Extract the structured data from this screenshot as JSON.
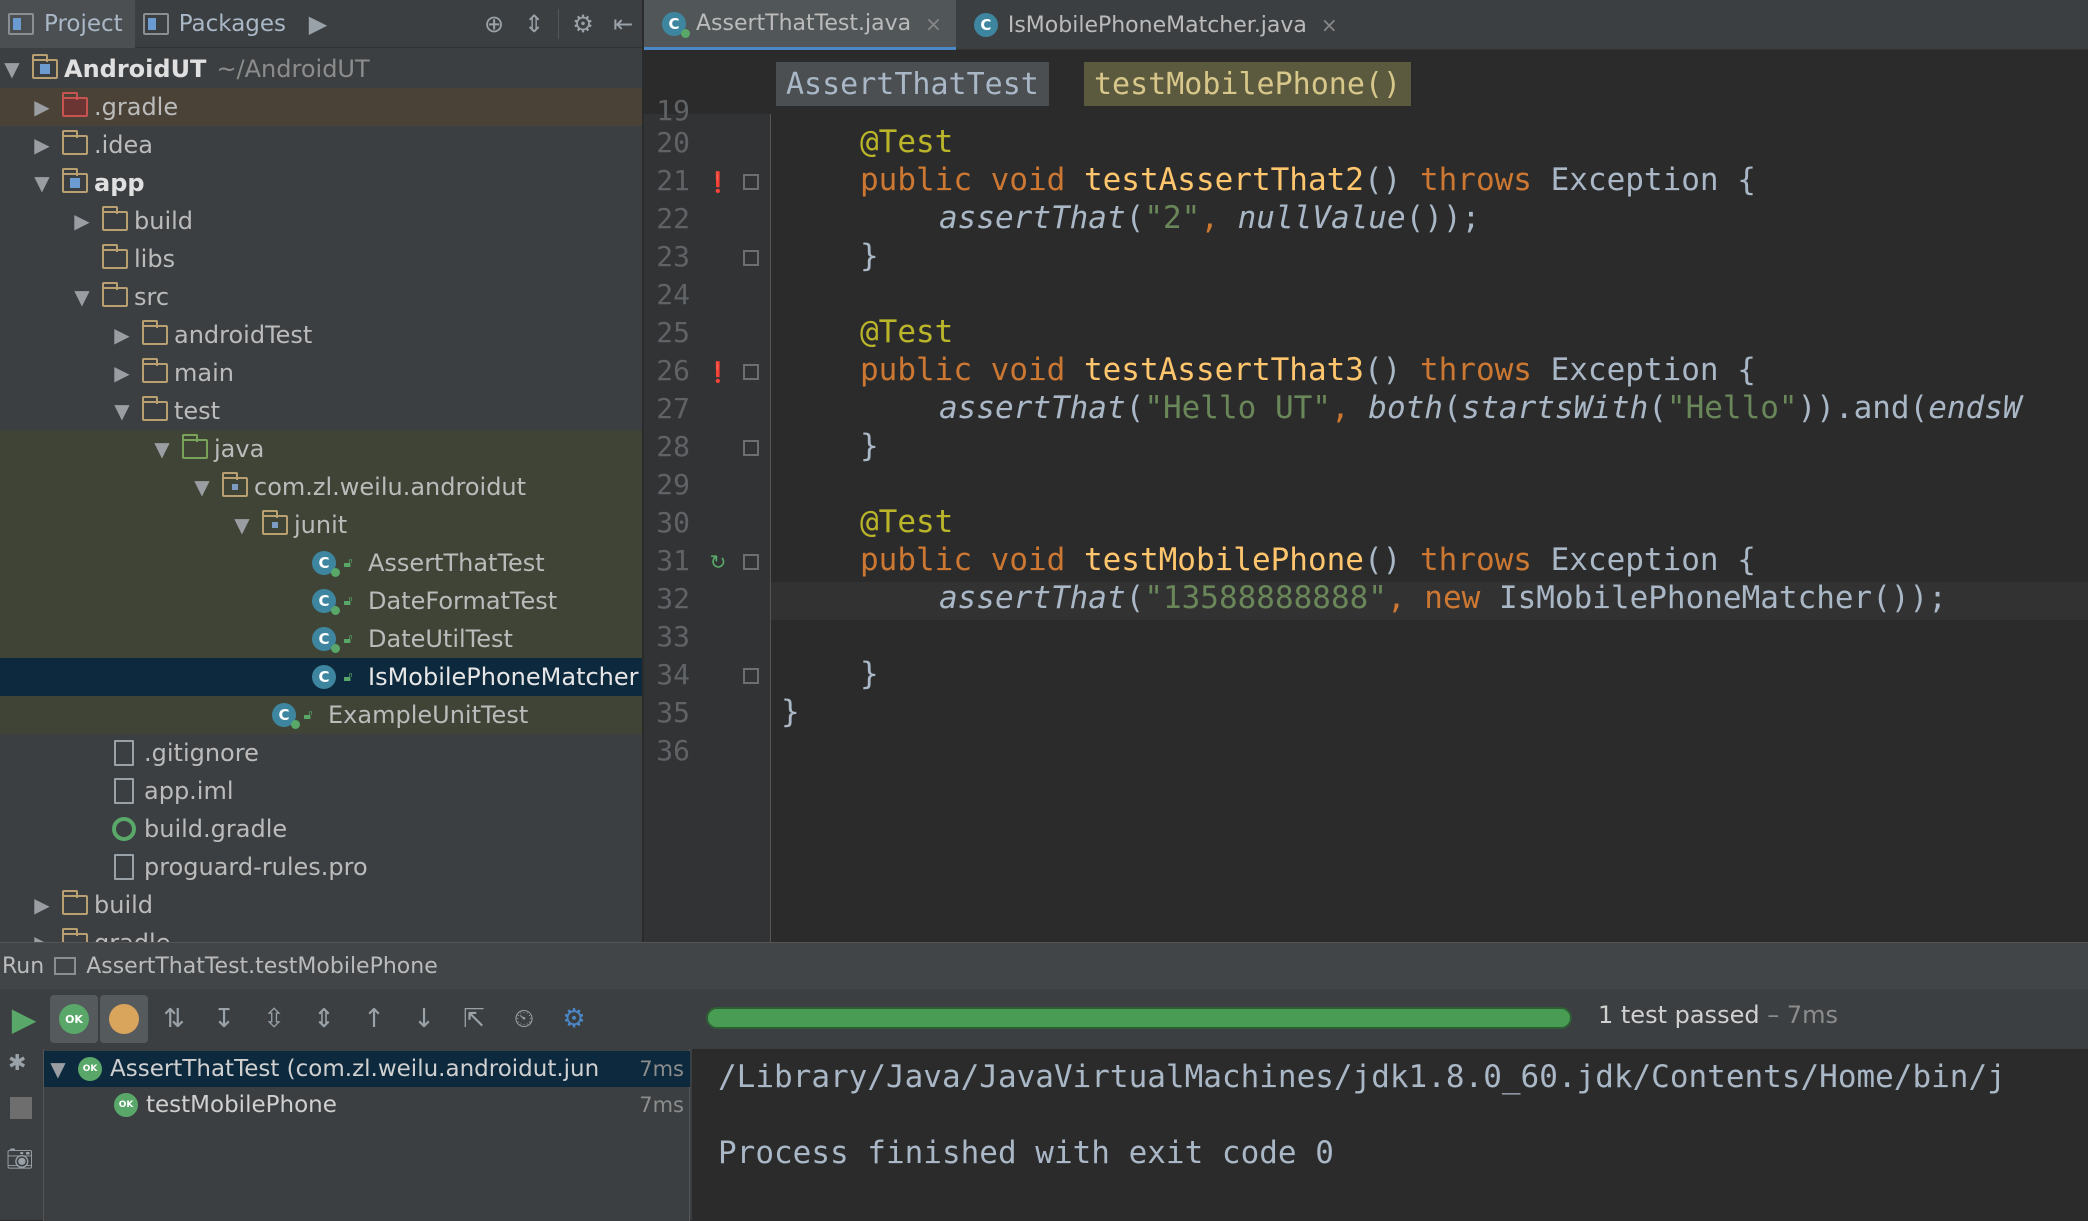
{
  "project_panel": {
    "tabs": [
      "Project",
      "Packages"
    ],
    "root_name": "AndroidUT",
    "root_path": "~/AndroidUT",
    "items": [
      {
        "label": ".gradle"
      },
      {
        "label": ".idea"
      },
      {
        "label": "app"
      },
      {
        "label": "build"
      },
      {
        "label": "libs"
      },
      {
        "label": "src"
      },
      {
        "label": "androidTest"
      },
      {
        "label": "main"
      },
      {
        "label": "test"
      },
      {
        "label": "java"
      },
      {
        "label": "com.zl.weilu.androidut"
      },
      {
        "label": "junit"
      },
      {
        "label": "AssertThatTest"
      },
      {
        "label": "DateFormatTest"
      },
      {
        "label": "DateUtilTest"
      },
      {
        "label": "IsMobilePhoneMatcher"
      },
      {
        "label": "ExampleUnitTest"
      },
      {
        "label": ".gitignore"
      },
      {
        "label": "app.iml"
      },
      {
        "label": "build.gradle"
      },
      {
        "label": "proguard-rules.pro"
      },
      {
        "label": "build"
      },
      {
        "label": "gradle"
      }
    ]
  },
  "editor": {
    "tabs": [
      {
        "label": "AssertThatTest.java",
        "close": "×"
      },
      {
        "label": "IsMobilePhoneMatcher.java",
        "close": "×"
      }
    ],
    "breadcrumb": [
      "AssertThatTest",
      "testMobilePhone()"
    ],
    "line_numbers": [
      "20",
      "21",
      "22",
      "23",
      "24",
      "25",
      "26",
      "27",
      "28",
      "29",
      "30",
      "31",
      "32",
      "33",
      "34",
      "35",
      "36"
    ],
    "code": {
      "ann": "@Test",
      "public": "public",
      "void": "void",
      "throws": "throws",
      "exception": "Exception {",
      "new": "new",
      "m1": "testAssertThat2",
      "m2": "testAssertThat3",
      "m3": "testMobilePhone",
      "call1_fn": "assertThat",
      "str_2": "\"2\"",
      "null_value": "nullValue",
      "str_hello_ut": "\"Hello UT\"",
      "both": "both",
      "starts_with": "startsWith",
      "str_hello": "\"Hello\"",
      "and_part": ".and(",
      "ends_part": "endsW",
      "str_phone": "\"13588888888\"",
      "matcher": "IsMobilePhoneMatcher());",
      "close_brace": "}",
      "paren_open": "(",
      "comma": ", ",
      "call_end": "());",
      "empty_parens": "() ",
      "close_paren": "))"
    }
  },
  "run_panel": {
    "title": "Run",
    "config": "AssertThatTest.testMobilePhone",
    "status_main": "1 test passed",
    "status_time": " – 7ms",
    "progress": 1.0,
    "results": [
      {
        "label": "AssertThatTest (com.zl.weilu.androidut.jun",
        "time": "7ms"
      },
      {
        "label": "testMobilePhone",
        "time": "7ms"
      }
    ],
    "console": [
      "/Library/Java/JavaVirtualMachines/jdk1.8.0_60.jdk/Contents/Home/bin/j",
      "Process finished with exit code 0"
    ],
    "ok_badge": "OK"
  }
}
